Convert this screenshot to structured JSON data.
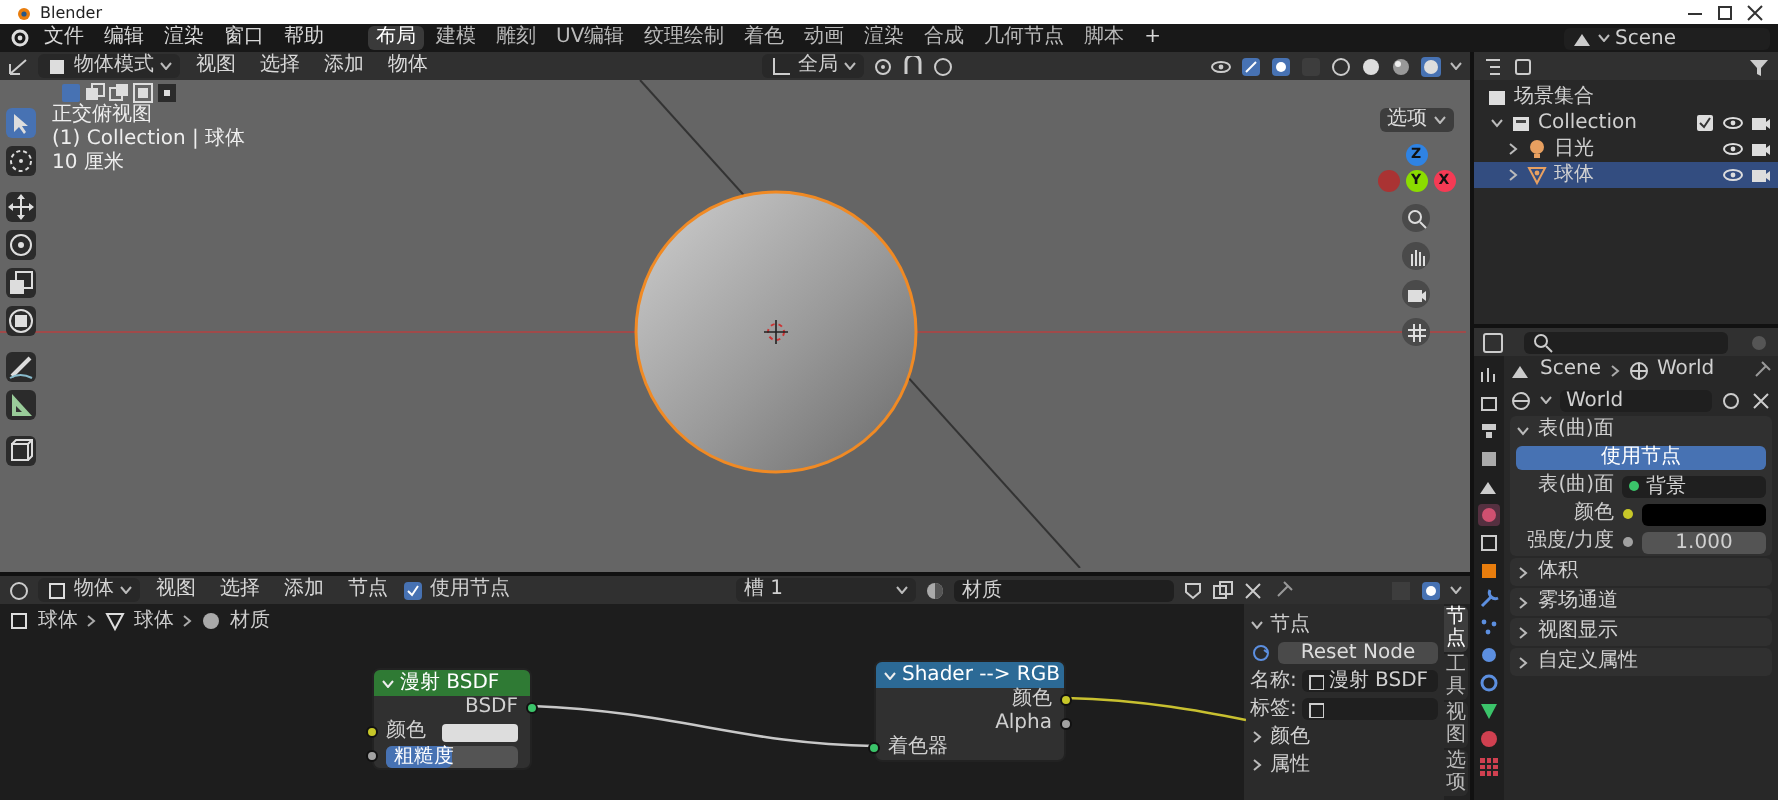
{
  "window": {
    "title": "Blender"
  },
  "menu": [
    "文件",
    "编辑",
    "渲染",
    "窗口",
    "帮助"
  ],
  "workspaces": [
    {
      "label": "布局",
      "selected": true
    },
    {
      "label": "建模",
      "selected": false
    },
    {
      "label": "雕刻",
      "selected": false
    },
    {
      "label": "UV编辑",
      "selected": false
    },
    {
      "label": "纹理绘制",
      "selected": false
    },
    {
      "label": "着色",
      "selected": false
    },
    {
      "label": "动画",
      "selected": false
    },
    {
      "label": "渲染",
      "selected": false
    },
    {
      "label": "合成",
      "selected": false
    },
    {
      "label": "几何节点",
      "selected": false
    },
    {
      "label": "脚本",
      "selected": false
    }
  ],
  "add_workspace": "+",
  "scene": "Scene",
  "viewport_header": {
    "mode": "物体模式",
    "menus": [
      "视图",
      "选择",
      "添加",
      "物体"
    ],
    "orientation": "全局",
    "options": "选项"
  },
  "viewport": {
    "view_name": "正交俯视图",
    "collection": "(1) Collection | 球体",
    "scale": "10 厘米",
    "gizmo_axes": [
      "Z",
      "Y",
      "X"
    ],
    "tools": [
      {
        "kind": "select",
        "selected": true
      },
      {
        "kind": "cursor",
        "selected": false
      },
      {
        "kind": "move",
        "selected": false
      },
      {
        "kind": "rotate",
        "selected": false
      },
      {
        "kind": "scale",
        "selected": false
      },
      {
        "kind": "transform",
        "selected": false
      },
      {
        "kind": "annotate",
        "selected": false
      },
      {
        "kind": "measure",
        "selected": false
      },
      {
        "kind": "add",
        "selected": false
      }
    ]
  },
  "outliner": {
    "root": "场景集合",
    "children": [
      {
        "label": "Collection",
        "kind": "collection",
        "expanded": true,
        "selected": false,
        "children": [
          {
            "label": "日光",
            "kind": "light",
            "expanded": false,
            "selected": false
          },
          {
            "label": "球体",
            "kind": "mesh",
            "expanded": false,
            "selected": true
          }
        ]
      }
    ]
  },
  "properties": {
    "breadcrumb": [
      "Scene",
      "World"
    ],
    "world_name": "World",
    "surface": {
      "title": "表(曲)面",
      "expanded": true,
      "button": "使用节点",
      "rows": [
        {
          "kind": "link",
          "label": "表(曲)面",
          "value": "背景"
        },
        {
          "kind": "color",
          "label": "颜色"
        },
        {
          "kind": "number",
          "label": "强度/力度",
          "value": "1.000"
        }
      ]
    },
    "panels": [
      {
        "title": "体积",
        "expanded": false
      },
      {
        "title": "雾场通道",
        "expanded": false
      },
      {
        "title": "视图显示",
        "expanded": false
      },
      {
        "title": "自定义属性",
        "expanded": false
      }
    ]
  },
  "node_editor": {
    "header": {
      "object": "物体",
      "menus": [
        "视图",
        "选择",
        "添加",
        "节点"
      ],
      "use_nodes": {
        "label": "使用节点",
        "checked": true
      },
      "slot": "槽 1",
      "material": "材质"
    },
    "breadcrumb": [
      "球体",
      "球体",
      "材质"
    ],
    "nodes": [
      {
        "kind": "shader",
        "title": "漫射 BSDF",
        "outputs": [
          "BSDF"
        ],
        "inputs": [
          {
            "kind": "color",
            "label": "颜色"
          },
          {
            "kind": "slider",
            "label": "粗糙度",
            "level": 0.5
          }
        ]
      },
      {
        "kind": "converter",
        "title": "Shader --> RGB",
        "outputs": [
          "颜色",
          "Alpha"
        ],
        "inputs": [
          {
            "kind": "socket",
            "label": "着色器"
          }
        ]
      }
    ],
    "sidebar": {
      "panel": "节点",
      "expanded": true,
      "reset": "Reset Node",
      "name_label": "名称:",
      "name": "漫射 BSDF",
      "label_label": "标签:",
      "subpanels": [
        {
          "title": "颜色",
          "expanded": false
        },
        {
          "title": "属性",
          "expanded": false
        }
      ],
      "tabs": [
        {
          "label": "节点",
          "selected": true
        },
        {
          "label": "工具",
          "selected": false
        },
        {
          "label": "视图",
          "selected": false
        },
        {
          "label": "选项",
          "selected": false
        }
      ]
    }
  }
}
